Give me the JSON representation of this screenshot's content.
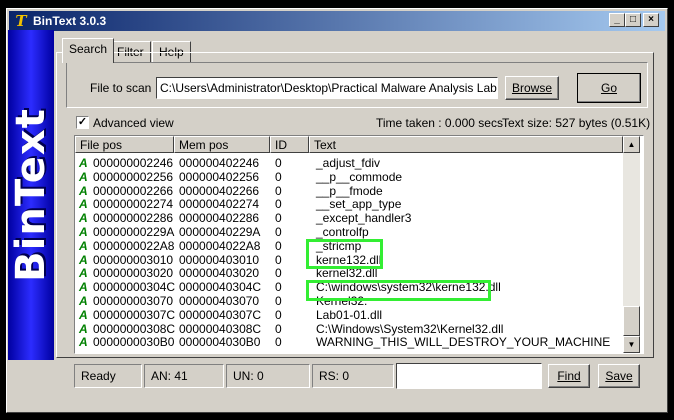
{
  "window": {
    "title": "BinText 3.0.3",
    "controls": {
      "minimize": "_",
      "maximize": "□",
      "close": "×"
    }
  },
  "sidebar": {
    "logo_text": "BinText"
  },
  "tabs": [
    {
      "label": "Search",
      "active": true
    },
    {
      "label": "Filter",
      "active": false
    },
    {
      "label": "Help",
      "active": false
    }
  ],
  "scan": {
    "file_label": "File to scan",
    "file_value": "C:\\Users\\Administrator\\Desktop\\Practical Malware Analysis Labs\\Binar",
    "browse_label": "Browse",
    "go_label": "Go"
  },
  "options": {
    "advanced_view_label": "Advanced view",
    "advanced_view_checked": true,
    "time_taken": "Time taken : 0.000 secs",
    "text_size": "Text size: 527 bytes (0.51K)"
  },
  "table": {
    "columns": [
      "File pos",
      "Mem pos",
      "ID",
      "Text"
    ],
    "rows": [
      {
        "type": "A",
        "file_pos": "000000002246",
        "mem_pos": "000000402246",
        "id": "0",
        "text": "_adjust_fdiv"
      },
      {
        "type": "A",
        "file_pos": "000000002256",
        "mem_pos": "000000402256",
        "id": "0",
        "text": "__p__commode"
      },
      {
        "type": "A",
        "file_pos": "000000002266",
        "mem_pos": "000000402266",
        "id": "0",
        "text": "__p__fmode"
      },
      {
        "type": "A",
        "file_pos": "000000002274",
        "mem_pos": "000000402274",
        "id": "0",
        "text": "__set_app_type"
      },
      {
        "type": "A",
        "file_pos": "000000002286",
        "mem_pos": "000000402286",
        "id": "0",
        "text": "_except_handler3"
      },
      {
        "type": "A",
        "file_pos": "00000000229A",
        "mem_pos": "00000040229A",
        "id": "0",
        "text": "_controlfp"
      },
      {
        "type": "A",
        "file_pos": "0000000022A8",
        "mem_pos": "0000004022A8",
        "id": "0",
        "text": "_stricmp"
      },
      {
        "type": "A",
        "file_pos": "000000003010",
        "mem_pos": "000000403010",
        "id": "0",
        "text": "kerne132.dll"
      },
      {
        "type": "A",
        "file_pos": "000000003020",
        "mem_pos": "000000403020",
        "id": "0",
        "text": "kernel32.dll"
      },
      {
        "type": "A",
        "file_pos": "00000000304C",
        "mem_pos": "00000040304C",
        "id": "0",
        "text": "C:\\windows\\system32\\kerne132.dll"
      },
      {
        "type": "A",
        "file_pos": "000000003070",
        "mem_pos": "000000403070",
        "id": "0",
        "text": "Kernel32."
      },
      {
        "type": "A",
        "file_pos": "00000000307C",
        "mem_pos": "00000040307C",
        "id": "0",
        "text": "Lab01-01.dll"
      },
      {
        "type": "A",
        "file_pos": "00000000308C",
        "mem_pos": "00000040308C",
        "id": "0",
        "text": "C:\\Windows\\System32\\Kernel32.dll"
      },
      {
        "type": "A",
        "file_pos": "0000000030B0",
        "mem_pos": "0000004030B0",
        "id": "0",
        "text": "WARNING_THIS_WILL_DESTROY_YOUR_MACHINE"
      }
    ]
  },
  "status": {
    "state": "Ready",
    "an": "AN: 41",
    "un": "UN: 0",
    "rs": "RS: 0",
    "search_value": "",
    "find_label": "Find",
    "save_label": "Save"
  },
  "colors": {
    "highlight": "#33ee33",
    "sidebar": "#1a1aff",
    "title_bar": "#0a246a"
  }
}
